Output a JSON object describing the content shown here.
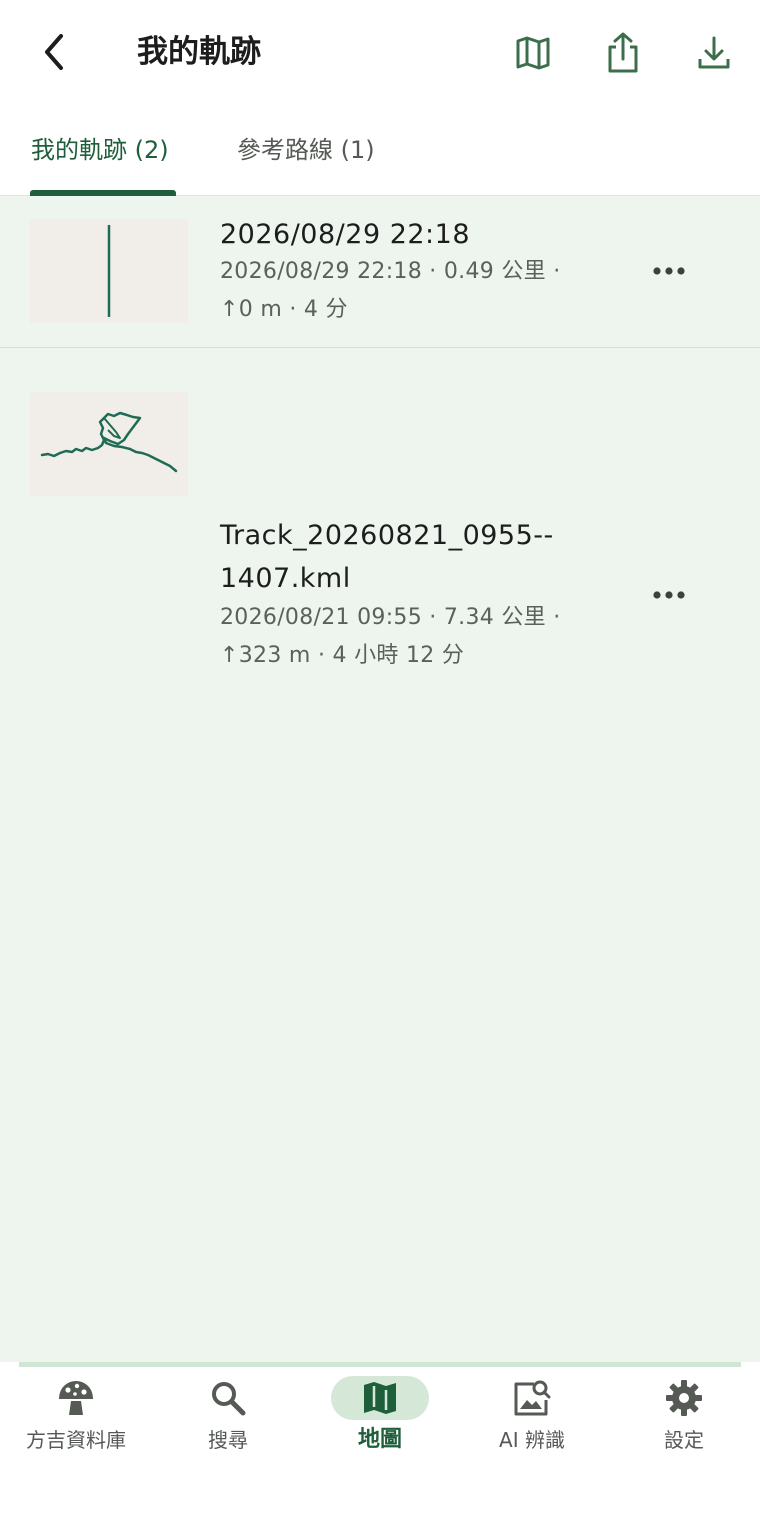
{
  "header": {
    "title": "我的軌跡",
    "icons": [
      "back-arrow-icon",
      "map-icon",
      "share-icon",
      "download-icon"
    ]
  },
  "tabs": [
    {
      "label": "我的軌跡 (2)",
      "active": true
    },
    {
      "label": "參考路線 (1)",
      "active": false
    }
  ],
  "tracks": [
    {
      "name": "2026/08/29 22:18",
      "meta_line1": "2026/08/29 22:18 · 0.49 公里 ·",
      "meta_line2": "↑0 m · 4 分"
    },
    {
      "name_line1": "Track_20260821_0955--",
      "name_line2": "1407.kml",
      "meta_line1": "2026/08/21 09:55 · 7.34 公里 ·",
      "meta_line2": "↑323 m · 4 小時 12 分"
    }
  ],
  "bottom_nav": [
    {
      "label": "方吉資料庫",
      "icon": "mushroom-icon",
      "active": false
    },
    {
      "label": "搜尋",
      "icon": "search-icon",
      "active": false
    },
    {
      "label": "地圖",
      "icon": "map-icon",
      "active": true
    },
    {
      "label": "AI 辨識",
      "icon": "image-search-icon",
      "active": false
    },
    {
      "label": "設定",
      "icon": "gear-icon",
      "active": false
    }
  ],
  "colors": {
    "accent": "#1f5e3a",
    "track_line": "#1f6b55",
    "background": "#eef5ee",
    "active_nav_pill": "#d5e8d8"
  }
}
